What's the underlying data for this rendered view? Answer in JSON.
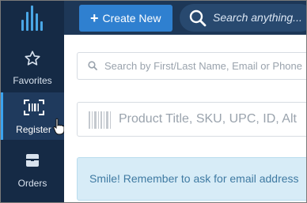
{
  "colors": {
    "sidebar_bg": "#152a45",
    "topbar_bg": "#1d3757",
    "accent": "#2f80d0",
    "alert_bg": "#d7ecf7",
    "alert_text": "#3f7aa2"
  },
  "sidebar": {
    "logo_icon": "equalizer-bars-logo",
    "items": [
      {
        "label": "Favorites",
        "icon": "star-icon",
        "active": false
      },
      {
        "label": "Register",
        "icon": "barcode-scan-icon",
        "active": true
      },
      {
        "label": "Orders",
        "icon": "box-icon",
        "active": false
      }
    ]
  },
  "topbar": {
    "create_label": "Create New",
    "create_icon": "plus-icon",
    "search_placeholder": "Search anything...",
    "search_icon": "search-icon"
  },
  "main": {
    "customer_search_placeholder": "Search by First/Last Name, Email or Phone",
    "product_search_placeholder": "Product Title, SKU, UPC, ID, Alt",
    "alert_text": "Smile! Remember to ask for email address"
  }
}
